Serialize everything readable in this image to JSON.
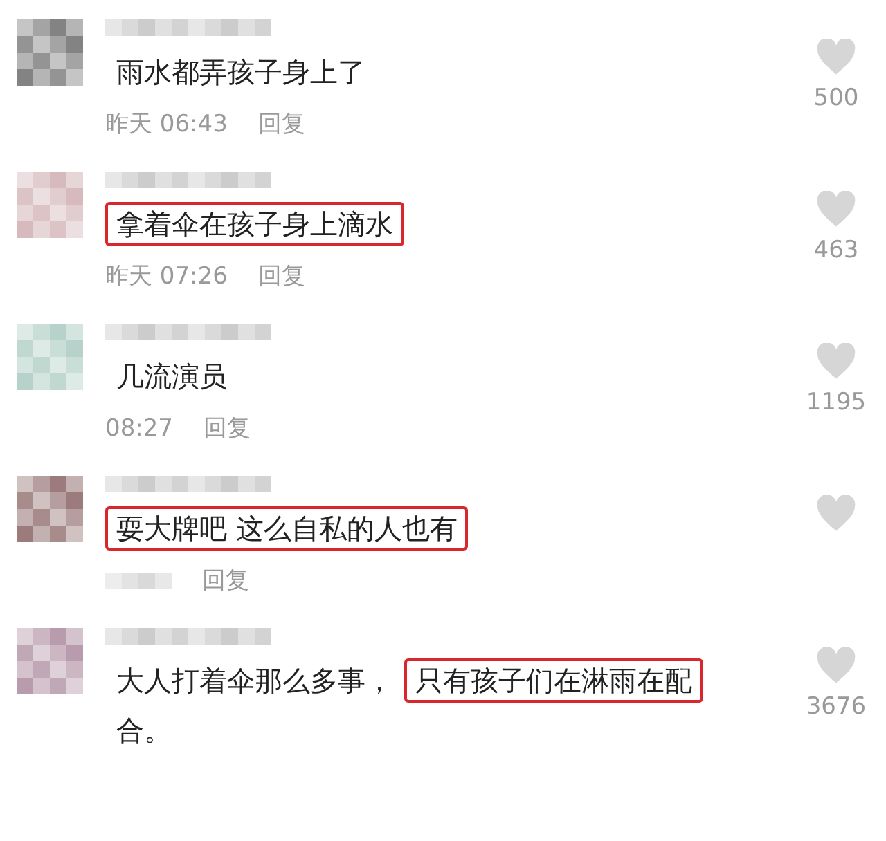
{
  "comments": [
    {
      "segments": [
        {
          "text": "雨水都弄孩子身上了",
          "highlighted": false
        }
      ],
      "time": "昨天 06:43",
      "reply": "回复",
      "likes": "500"
    },
    {
      "segments": [
        {
          "text": "拿着伞在孩子身上滴水",
          "highlighted": true
        }
      ],
      "time": "昨天 07:26",
      "reply": "回复",
      "likes": "463"
    },
    {
      "segments": [
        {
          "text": "几流演员",
          "highlighted": false
        }
      ],
      "time": "08:27",
      "reply": "回复",
      "likes": "1195"
    },
    {
      "segments": [
        {
          "text": "耍大牌吧 这么自私的人也有",
          "highlighted": true
        }
      ],
      "reply": "回复"
    },
    {
      "segments": [
        {
          "text": "大人打着伞那么多事，",
          "highlighted": false
        },
        {
          "text": "只有孩子们在淋雨在配",
          "highlighted": true
        },
        {
          "text": "合。",
          "highlighted": false
        }
      ],
      "likes": "3676"
    }
  ]
}
